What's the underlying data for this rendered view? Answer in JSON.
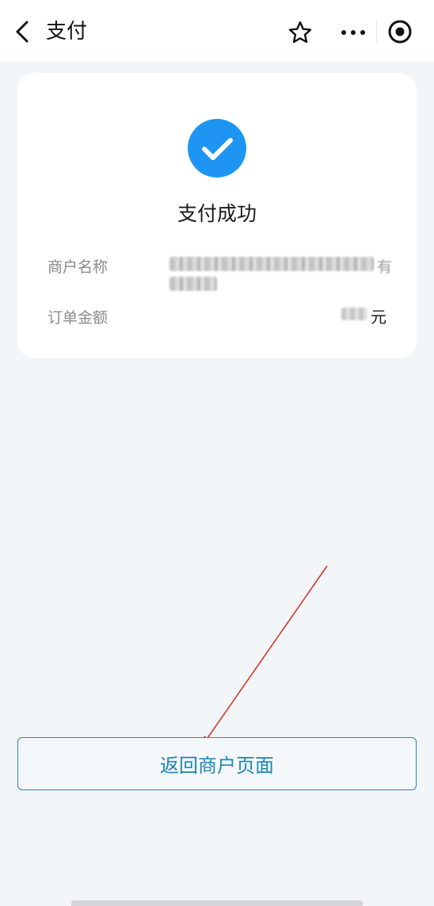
{
  "header": {
    "title": "支付"
  },
  "result": {
    "status": "支付成功",
    "merchant_label": "商户名称",
    "merchant_value_tail": "有",
    "amount_label": "订单金额",
    "amount_unit": "元"
  },
  "actions": {
    "return_label": "返回商户页面"
  },
  "colors": {
    "accent": "#1a8bbd",
    "success": "#1e95f2",
    "annotation_arrow": "#d8362a"
  },
  "icons": [
    "back-arrow-icon",
    "star-icon",
    "more-icon",
    "target-icon",
    "success-check-icon"
  ]
}
